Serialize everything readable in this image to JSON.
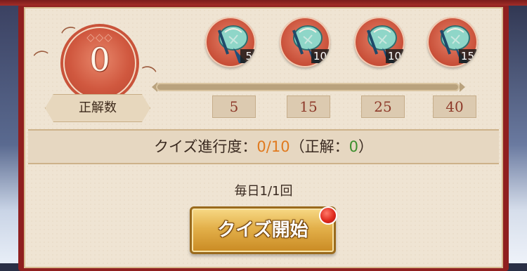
{
  "progress": {
    "correct_count": "0",
    "correct_label": "正解数",
    "progress_fraction": 0.0,
    "rewards": [
      {
        "icon": "fan-pouch-icon",
        "count": "5",
        "threshold": "5"
      },
      {
        "icon": "fan-pouch-icon",
        "count": "10",
        "threshold": "15"
      },
      {
        "icon": "fan-pouch-icon",
        "count": "10",
        "threshold": "25"
      },
      {
        "icon": "fan-pouch-icon",
        "count": "15",
        "threshold": "40"
      }
    ]
  },
  "quiz": {
    "progress_label": "クイズ進行度：",
    "progress_value": "0/10",
    "correct_open": "（正解：",
    "correct_value": "0",
    "correct_close": "）",
    "daily_label": "毎日1/1回",
    "start_label": "クイズ開始"
  },
  "colors": {
    "frame": "#8f1f1f",
    "panel": "#efe4d3",
    "badge": "#d0583f",
    "progress_orange": "#e07a1f",
    "correct_green": "#3d8f2e",
    "button_gold": "#e3b04a"
  }
}
